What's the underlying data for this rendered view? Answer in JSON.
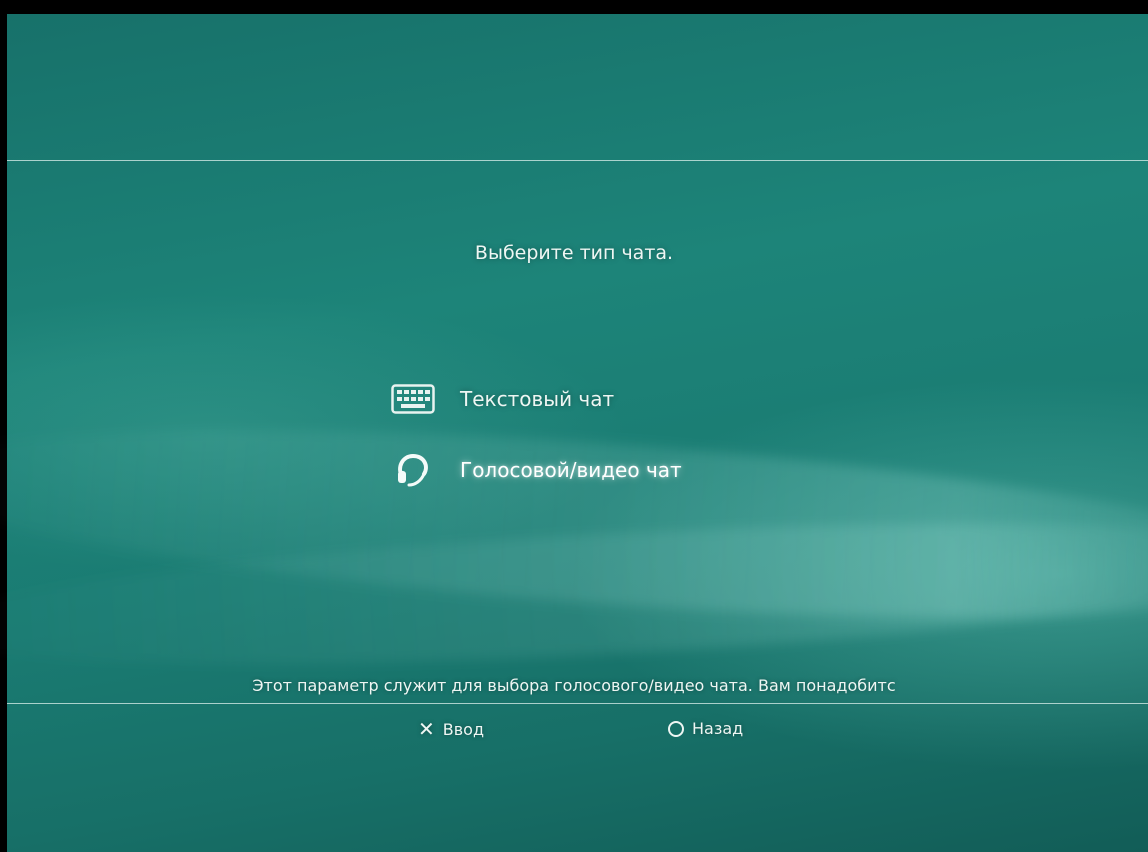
{
  "screen": {
    "prompt": "Выберите тип чата.",
    "options": [
      {
        "icon": "keyboard-icon",
        "label": "Текстовый чат",
        "selected": false
      },
      {
        "icon": "headset-icon",
        "label": "Голосовой/видео чат",
        "selected": true
      }
    ],
    "description": "Этот параметр служит для выбора голосового/видео чата. Вам понадобитс",
    "hints": {
      "enter": {
        "icon": "cross-button-icon",
        "glyph": "✕",
        "label": "Ввод"
      },
      "back": {
        "icon": "circle-button-icon",
        "label": "Назад"
      }
    }
  },
  "colors": {
    "background": "#1a7b72",
    "text": "#eef6f3",
    "rule": "#dcf0ec"
  }
}
